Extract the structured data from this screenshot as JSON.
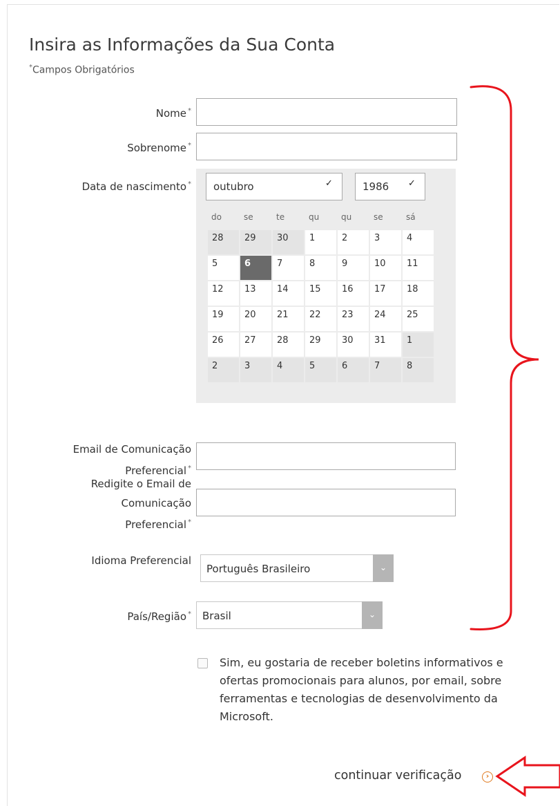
{
  "form": {
    "title": "Insira as Informações da Sua Conta",
    "required_note": "Campos Obrigatórios",
    "required_star": "*",
    "fields": {
      "first_name_label": "Nome",
      "first_name_value": "",
      "last_name_label": "Sobrenome",
      "last_name_value": "",
      "dob_label": "Data de nascimento",
      "email_label_line1": "Email de Comunicação",
      "email_label_line2": "Preferencial",
      "email_value": "",
      "email_confirm_label_line1": "Redigite o Email de",
      "email_confirm_label_line2": "Comunicação",
      "email_confirm_label_line3": "Preferencial",
      "email_confirm_value": "",
      "language_label": "Idioma Preferencial",
      "language_value": "Português Brasileiro",
      "country_label": "País/Região",
      "country_value": "Brasil"
    },
    "newsletter_text": "Sim, eu gostaria de receber boletins informativos e ofertas promocionais para alunos, por email, sobre ferramentas e tecnologias de desenvolvimento da Microsoft.",
    "continue_label": "continuar verificação"
  },
  "calendar": {
    "month": "outubro",
    "year": "1986",
    "weekdays": [
      "do",
      "se",
      "te",
      "qu",
      "qu",
      "se",
      "sá"
    ],
    "weeks": [
      [
        {
          "d": "28",
          "o": true
        },
        {
          "d": "29",
          "o": true
        },
        {
          "d": "30",
          "o": true
        },
        {
          "d": "1"
        },
        {
          "d": "2"
        },
        {
          "d": "3"
        },
        {
          "d": "4"
        }
      ],
      [
        {
          "d": "5"
        },
        {
          "d": "6",
          "s": true
        },
        {
          "d": "7"
        },
        {
          "d": "8"
        },
        {
          "d": "9"
        },
        {
          "d": "10"
        },
        {
          "d": "11"
        }
      ],
      [
        {
          "d": "12"
        },
        {
          "d": "13"
        },
        {
          "d": "14"
        },
        {
          "d": "15"
        },
        {
          "d": "16"
        },
        {
          "d": "17"
        },
        {
          "d": "18"
        }
      ],
      [
        {
          "d": "19"
        },
        {
          "d": "20"
        },
        {
          "d": "21"
        },
        {
          "d": "22"
        },
        {
          "d": "23"
        },
        {
          "d": "24"
        },
        {
          "d": "25"
        }
      ],
      [
        {
          "d": "26"
        },
        {
          "d": "27"
        },
        {
          "d": "28"
        },
        {
          "d": "29"
        },
        {
          "d": "30"
        },
        {
          "d": "31"
        },
        {
          "d": "1",
          "o": true
        }
      ],
      [
        {
          "d": "2",
          "o": true
        },
        {
          "d": "3",
          "o": true
        },
        {
          "d": "4",
          "o": true
        },
        {
          "d": "5",
          "o": true
        },
        {
          "d": "6",
          "o": true
        },
        {
          "d": "7",
          "o": true
        },
        {
          "d": "8",
          "o": true
        }
      ]
    ],
    "selected_day": "6"
  },
  "icons": {
    "select_chevron": "chevron-down-icon",
    "continue": "arrow-right-circle-icon"
  },
  "colors": {
    "annotation_red": "#e8141c",
    "accent_orange": "#e07a1f",
    "selected_day": "#6a6a6a"
  }
}
